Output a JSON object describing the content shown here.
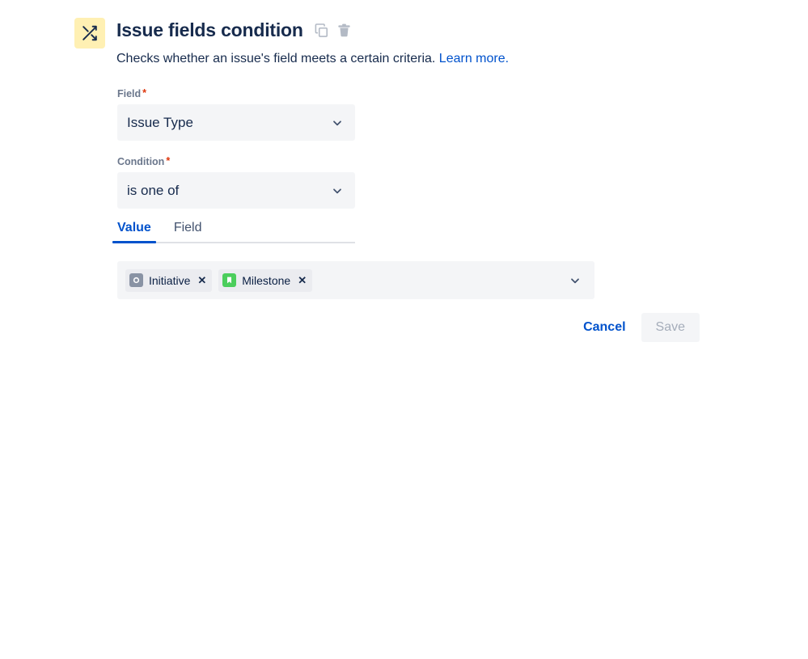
{
  "header": {
    "icon_name": "shuffle-icon",
    "icon_bg": "#FFF0B3",
    "icon_color": "#172B4D",
    "title": "Issue fields condition",
    "copy_icon": "copy-icon",
    "delete_icon": "trash-icon",
    "description_text": "Checks whether an issue's field meets a certain criteria.",
    "learn_more_label": "Learn more.",
    "link_color": "#0052CC"
  },
  "form": {
    "field": {
      "label": "Field",
      "required_marker": "*",
      "value": "Issue Type"
    },
    "condition": {
      "label": "Condition",
      "required_marker": "*",
      "value": "is one of"
    },
    "tabs": [
      {
        "label": "Value",
        "active": true
      },
      {
        "label": "Field",
        "active": false
      }
    ],
    "value_select": {
      "chips": [
        {
          "label": "Initiative",
          "icon_name": "initiative-circle-icon",
          "icon_bg": "#8993A4",
          "remove_label": "✕"
        },
        {
          "label": "Milestone",
          "icon_name": "milestone-bookmark-icon",
          "icon_bg": "#4BCE5C",
          "remove_label": "✕"
        }
      ]
    }
  },
  "actions": {
    "cancel_label": "Cancel",
    "save_label": "Save",
    "save_disabled": true
  }
}
